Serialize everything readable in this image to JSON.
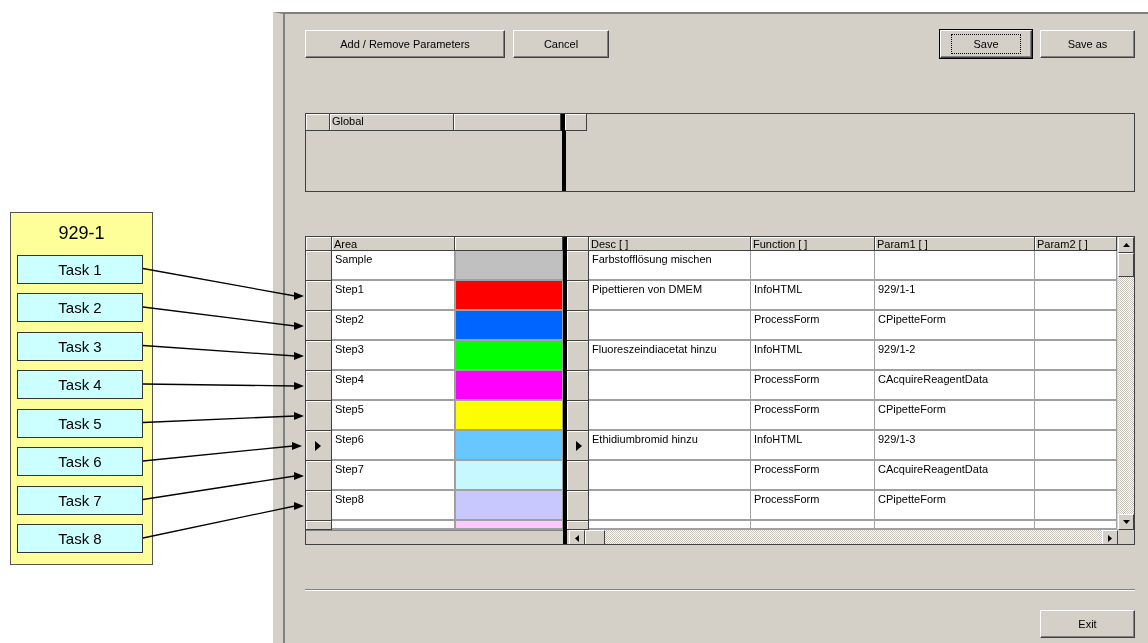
{
  "task_group": {
    "title": "929-1",
    "tasks": [
      {
        "label": "Task 1"
      },
      {
        "label": "Task 2"
      },
      {
        "label": "Task 3"
      },
      {
        "label": "Task 4"
      },
      {
        "label": "Task 5"
      },
      {
        "label": "Task 6"
      },
      {
        "label": "Task 7"
      },
      {
        "label": "Task 8"
      }
    ]
  },
  "toolbar": {
    "left_buttons": [
      {
        "label": "Add / Remove Parameters",
        "default": false
      },
      {
        "label": "Cancel",
        "default": false
      }
    ],
    "right_buttons": [
      {
        "label": "Save",
        "default": true
      },
      {
        "label": "Save as",
        "default": false
      }
    ]
  },
  "global_grid": {
    "columns": [
      "Global"
    ]
  },
  "step_grid": {
    "left_columns": [
      "Area"
    ],
    "right_columns": [
      "Desc  [ ]",
      "Function  [ ]",
      "Param1  [ ]",
      "Param2  [ ]"
    ],
    "rows": [
      {
        "area": "Sample",
        "color": "#c0c0c0",
        "desc": "Farbstofflösung mischen",
        "current": false
      },
      {
        "area": "Step1",
        "color": "#ff0000",
        "desc": "Pipettieren von DMEM",
        "function": " InfoHTML",
        "param1": "929/1-1",
        "current": false
      },
      {
        "area": "Step2",
        "color": "#0064ff",
        "function": "ProcessForm",
        "param1": "CPipetteForm",
        "current": false
      },
      {
        "area": "Step3",
        "color": "#00ff00",
        "desc": "Fluoreszeindiacetat hinzu",
        "function": "InfoHTML",
        "param1": "929/1-2",
        "current": false
      },
      {
        "area": "Step4",
        "color": "#ff00ff",
        "function": "ProcessForm",
        "param1": "CAcquireReagentData",
        "current": false
      },
      {
        "area": "Step5",
        "color": "#ffff00",
        "function": "ProcessForm",
        "param1": "CPipetteForm",
        "current": false
      },
      {
        "area": "Step6",
        "color": "#66c8ff",
        "desc": "Ethidiumbromid hinzu",
        "function": "InfoHTML",
        "param1": "929/1-3",
        "current": true
      },
      {
        "area": "Step7",
        "color": "#c8f8ff",
        "function": "ProcessForm",
        "param1": "CAcquireReagentData",
        "current": false
      },
      {
        "area": "Step8",
        "color": "#c8c8ff",
        "function": "ProcessForm",
        "param1": "CPipetteForm",
        "current": false
      }
    ],
    "partial_row": {
      "color": "#ffc8ff"
    }
  },
  "footer": {
    "button": "Exit"
  }
}
